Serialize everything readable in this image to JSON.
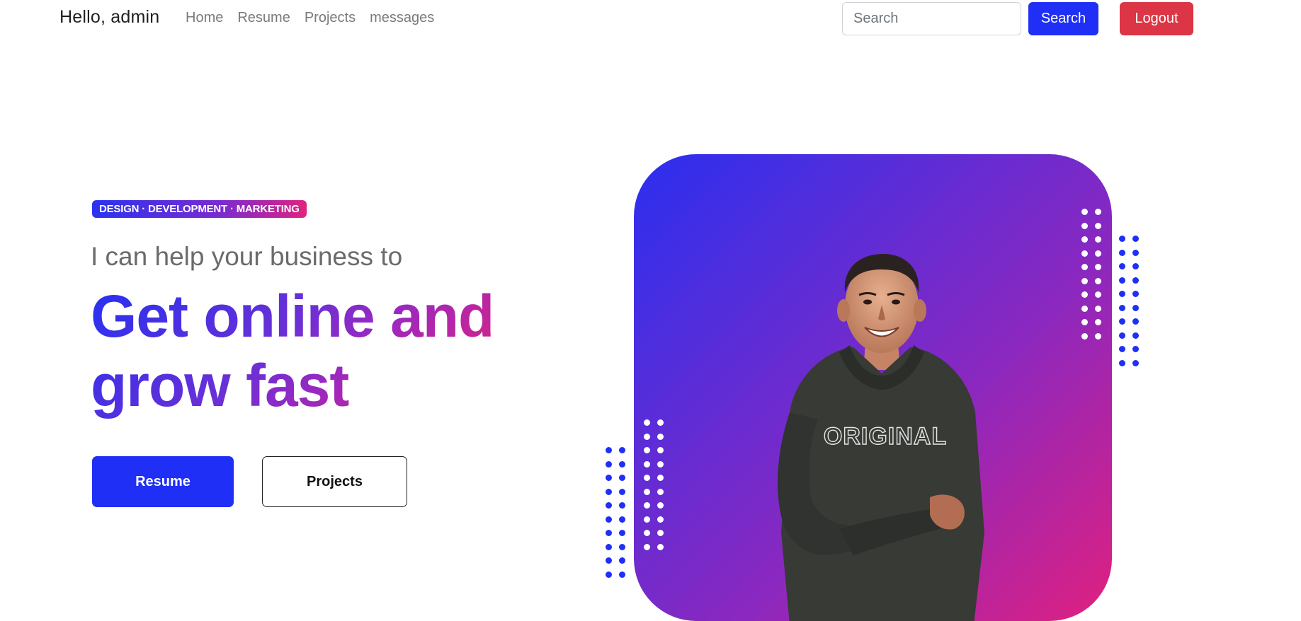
{
  "navbar": {
    "brand": "Hello, admin",
    "links": [
      "Home",
      "Resume",
      "Projects",
      "messages"
    ],
    "search_placeholder": "Search",
    "search_button": "Search",
    "logout_button": "Logout"
  },
  "hero": {
    "tag": "DESIGN · DEVELOPMENT · MARKETING",
    "subtitle": "I can help your business to",
    "title": "Get online and grow fast",
    "resume_button": "Resume",
    "projects_button": "Projects",
    "photo_shirt_text": "ORIGINAL"
  },
  "colors": {
    "primary": "#1f2ff5",
    "danger": "#dc3545",
    "gradient_start": "#2a2ff0",
    "gradient_end": "#e0207f"
  },
  "icons": {
    "decorative": [
      "dot-pattern-icon"
    ]
  }
}
